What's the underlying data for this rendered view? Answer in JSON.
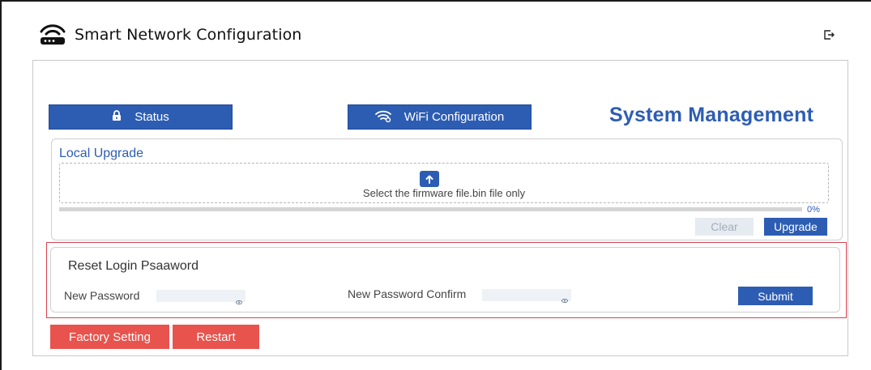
{
  "header": {
    "title": "Smart Network Configuration",
    "logo_icon": "router-wifi-icon",
    "logout_icon": "logout-icon"
  },
  "nav": {
    "status_label": "Status",
    "status_icon": "lock-icon",
    "wifi_label": "WiFi Configuration",
    "wifi_icon": "wifi-icon"
  },
  "page": {
    "heading": "System Management"
  },
  "local_upgrade": {
    "title": "Local Upgrade",
    "dropzone_text": "Select the firmware file.bin file only",
    "upload_icon": "upload-icon",
    "progress": 0,
    "progress_label": "0%",
    "clear_label": "Clear",
    "upgrade_label": "Upgrade"
  },
  "reset_password": {
    "title": "Reset Login Psaaword",
    "new_password_label": "New Password",
    "new_password_value": "",
    "confirm_label": "New Password Confirm",
    "confirm_value": "",
    "submit_label": "Submit",
    "eye_icon": "eye-icon"
  },
  "actions": {
    "factory_label": "Factory Setting",
    "restart_label": "Restart"
  },
  "colors": {
    "primary": "#2d5db3",
    "danger": "#e8534e",
    "highlight_border": "#d9414f",
    "disabled_bg": "#e6ebf2",
    "disabled_text": "#a4adb9"
  }
}
